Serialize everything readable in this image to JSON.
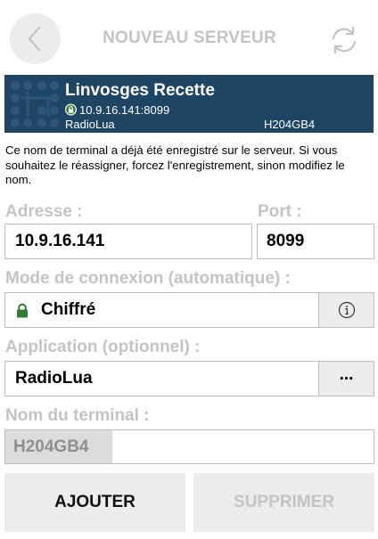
{
  "header": {
    "title": "NOUVEAU SERVEUR"
  },
  "server": {
    "name": "Linvosges Recette",
    "address": "10.9.16.141:8099",
    "application": "RadioLua",
    "terminal": "H204GB4"
  },
  "warning_text": "Ce nom de terminal a déjà été enregistré sur le serveur. Si vous souhaitez le réassigner, forcez l'enregistrement, sinon modifiez le nom.",
  "form": {
    "address_label": "Adresse :",
    "address_value": "10.9.16.141",
    "port_label": "Port :",
    "port_value": "8099",
    "connection_label": "Mode de connexion (automatique) :",
    "connection_value": "Chiffré",
    "application_label": "Application (optionnel) :",
    "application_value": "RadioLua",
    "application_more": "...",
    "terminal_label": "Nom du terminal :",
    "terminal_prefix": "H204GB4",
    "terminal_value": ""
  },
  "buttons": {
    "add": "AJOUTER",
    "delete": "SUPPRIMER"
  },
  "colors": {
    "card_background": "#1f4565",
    "lock_green": "#2e7d32",
    "disabled_text": "#c4c4c4"
  },
  "icons": {
    "back": "chevron-left-icon",
    "refresh": "refresh-icon",
    "lock": "lock-icon",
    "info": "info-icon"
  }
}
